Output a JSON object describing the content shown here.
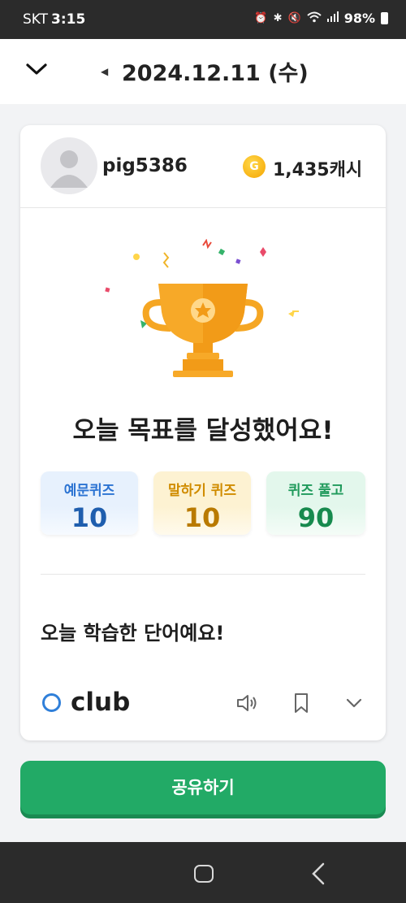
{
  "status_bar": {
    "carrier": "SKT",
    "time": "3:15",
    "battery": "98%"
  },
  "header": {
    "date": "2024.12.11 (수)"
  },
  "profile": {
    "username": "pig5386",
    "coin_symbol": "G",
    "cash": "1,435캐시"
  },
  "achievement": {
    "title": "오늘 목표를 달성했어요!"
  },
  "stats": [
    {
      "label": "예문퀴즈",
      "value": "10"
    },
    {
      "label": "말하기 퀴즈",
      "value": "10"
    },
    {
      "label": "퀴즈 풀고",
      "value": "90"
    }
  ],
  "learned": {
    "title": "오늘 학습한 단어예요!",
    "word": "club"
  },
  "share_button": "공유하기",
  "colors": {
    "accent_green": "#22aa66",
    "blue": "#2b73d2",
    "yellow": "#d08c00",
    "green": "#1f9a5b",
    "trophy": "#f5a623"
  }
}
